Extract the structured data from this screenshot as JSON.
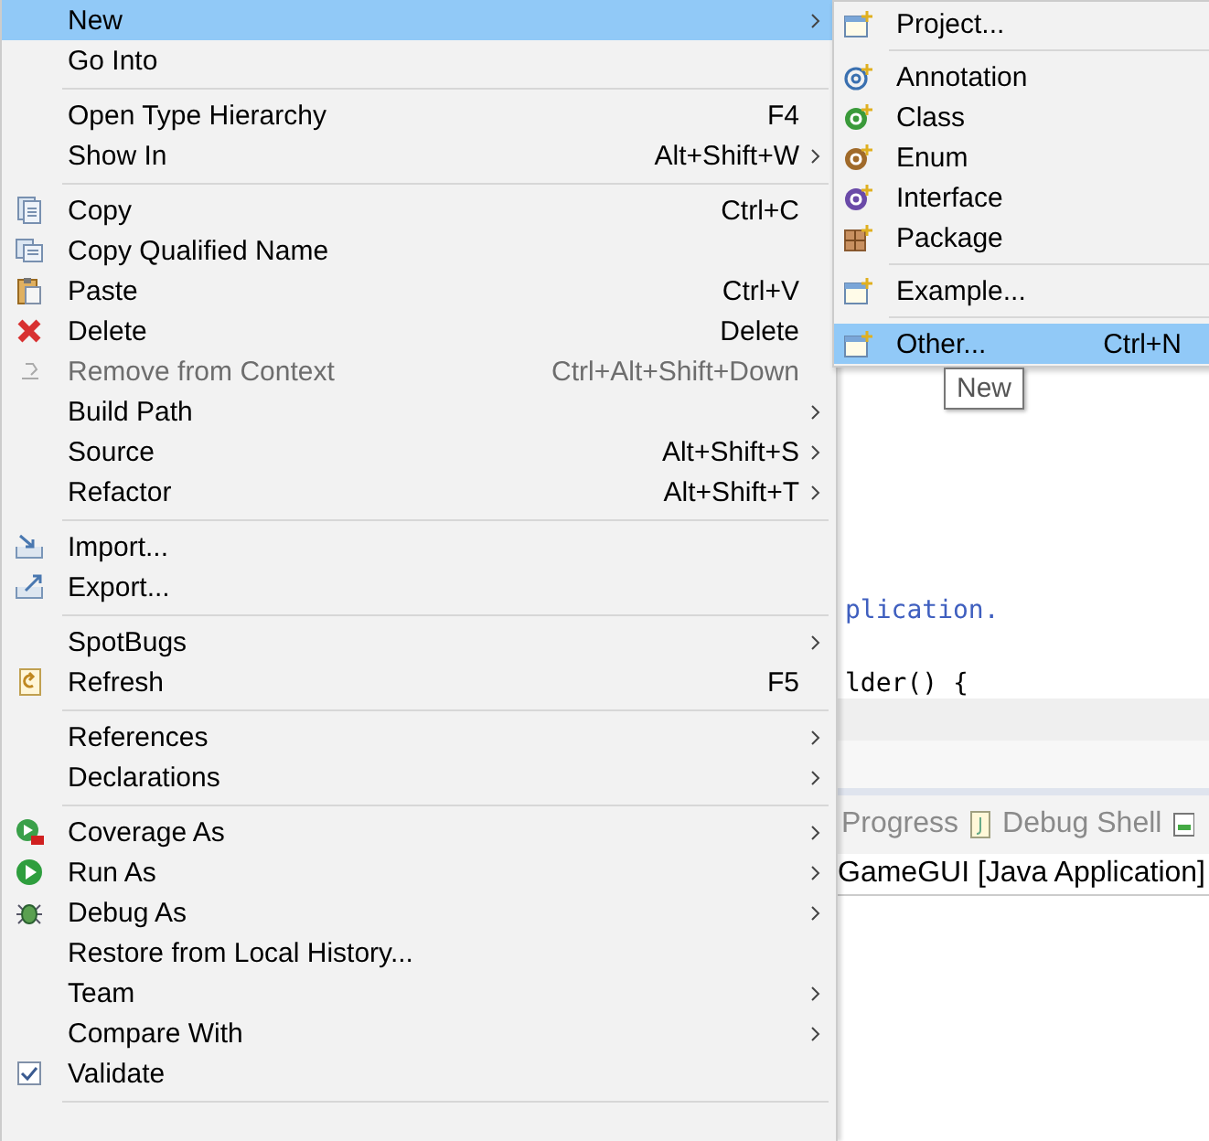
{
  "editor": {
    "code_lines": [
      {
        "text": "plication.",
        "kind": "comment"
      },
      {
        "kind": "blank"
      },
      {
        "text": "lder() {",
        "kind": "code"
      }
    ]
  },
  "console": {
    "tabs": [
      {
        "label": "Progress"
      },
      {
        "label": "Debug Shell"
      }
    ],
    "launch": "GameGUI [Java Application]"
  },
  "context_menu": {
    "items": [
      {
        "kind": "item",
        "label": "New",
        "submenu": true,
        "disabled": false,
        "selected": true
      },
      {
        "kind": "item",
        "label": "Go Into",
        "submenu": false,
        "disabled": false,
        "selected": false
      },
      {
        "kind": "separator"
      },
      {
        "kind": "item",
        "label": "Open Type Hierarchy",
        "shortcut": "F4",
        "submenu": false,
        "disabled": false,
        "selected": false
      },
      {
        "kind": "item",
        "label": "Show In",
        "shortcut": "Alt+Shift+W",
        "submenu": true,
        "disabled": false,
        "selected": false
      },
      {
        "kind": "separator"
      },
      {
        "kind": "item",
        "label": "Copy",
        "shortcut": "Ctrl+C",
        "submenu": false,
        "disabled": false,
        "selected": false
      },
      {
        "kind": "item",
        "label": "Copy Qualified Name",
        "submenu": false,
        "disabled": false,
        "selected": false
      },
      {
        "kind": "item",
        "label": "Paste",
        "shortcut": "Ctrl+V",
        "submenu": false,
        "disabled": false,
        "selected": false
      },
      {
        "kind": "item",
        "label": "Delete",
        "shortcut": "Delete",
        "submenu": false,
        "disabled": false,
        "selected": false
      },
      {
        "kind": "item",
        "label": "Remove from Context",
        "shortcut": "Ctrl+Alt+Shift+Down",
        "submenu": false,
        "disabled": true,
        "selected": false
      },
      {
        "kind": "item",
        "label": "Build Path",
        "submenu": true,
        "disabled": false,
        "selected": false
      },
      {
        "kind": "item",
        "label": "Source",
        "shortcut": "Alt+Shift+S",
        "submenu": true,
        "disabled": false,
        "selected": false
      },
      {
        "kind": "item",
        "label": "Refactor",
        "shortcut": "Alt+Shift+T",
        "submenu": true,
        "disabled": false,
        "selected": false
      },
      {
        "kind": "separator"
      },
      {
        "kind": "item",
        "label": "Import...",
        "submenu": false,
        "disabled": false,
        "selected": false
      },
      {
        "kind": "item",
        "label": "Export...",
        "submenu": false,
        "disabled": false,
        "selected": false
      },
      {
        "kind": "separator"
      },
      {
        "kind": "item",
        "label": "SpotBugs",
        "submenu": true,
        "disabled": false,
        "selected": false
      },
      {
        "kind": "item",
        "label": "Refresh",
        "shortcut": "F5",
        "submenu": false,
        "disabled": false,
        "selected": false
      },
      {
        "kind": "separator"
      },
      {
        "kind": "item",
        "label": "References",
        "submenu": true,
        "disabled": false,
        "selected": false
      },
      {
        "kind": "item",
        "label": "Declarations",
        "submenu": true,
        "disabled": false,
        "selected": false
      },
      {
        "kind": "separator"
      },
      {
        "kind": "item",
        "label": "Coverage As",
        "submenu": true,
        "disabled": false,
        "selected": false
      },
      {
        "kind": "item",
        "label": "Run As",
        "submenu": true,
        "disabled": false,
        "selected": false
      },
      {
        "kind": "item",
        "label": "Debug As",
        "submenu": true,
        "disabled": false,
        "selected": false
      },
      {
        "kind": "item",
        "label": "Restore from Local History...",
        "submenu": false,
        "disabled": false,
        "selected": false
      },
      {
        "kind": "item",
        "label": "Team",
        "submenu": true,
        "disabled": false,
        "selected": false
      },
      {
        "kind": "item",
        "label": "Compare With",
        "submenu": true,
        "disabled": false,
        "selected": false
      },
      {
        "kind": "item",
        "label": "Validate",
        "submenu": false,
        "disabled": false,
        "selected": false
      },
      {
        "kind": "separator"
      }
    ]
  },
  "new_submenu": {
    "items": [
      {
        "kind": "item",
        "label": "Project...",
        "selected": false
      },
      {
        "kind": "separator"
      },
      {
        "kind": "item",
        "label": "Annotation",
        "selected": false
      },
      {
        "kind": "item",
        "label": "Class",
        "selected": false
      },
      {
        "kind": "item",
        "label": "Enum",
        "selected": false
      },
      {
        "kind": "item",
        "label": "Interface",
        "selected": false
      },
      {
        "kind": "item",
        "label": "Package",
        "selected": false
      },
      {
        "kind": "separator"
      },
      {
        "kind": "item",
        "label": "Example...",
        "selected": false
      },
      {
        "kind": "separator"
      },
      {
        "kind": "item",
        "label": "Other...",
        "shortcut": "Ctrl+N",
        "selected": true
      }
    ]
  },
  "tooltip": "New"
}
